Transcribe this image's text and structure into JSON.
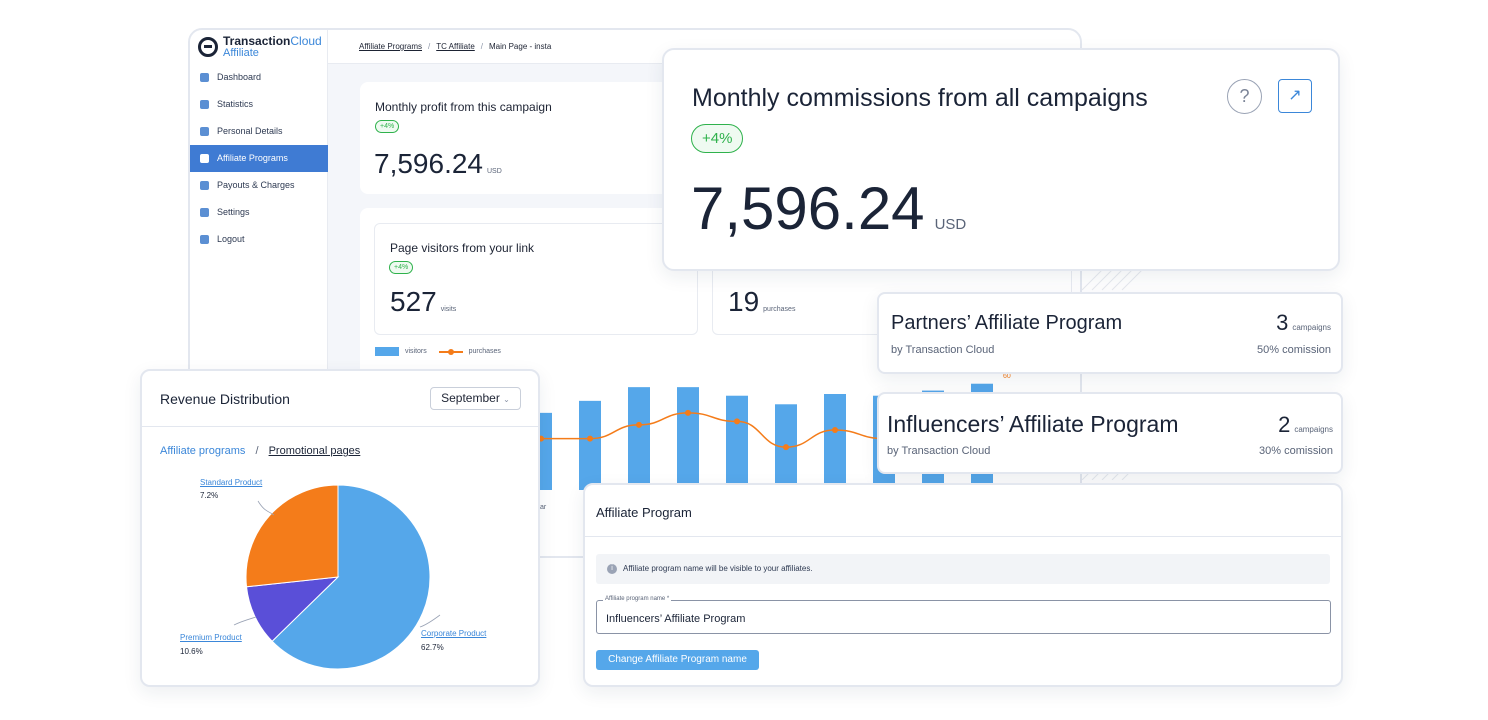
{
  "app": {
    "brand": "Transaction",
    "brand_suffix": "Cloud",
    "product": "Affiliate"
  },
  "sidebar": {
    "items": [
      {
        "label": "Dashboard",
        "icon": "bar-chart-icon"
      },
      {
        "label": "Statistics",
        "icon": "stats-icon"
      },
      {
        "label": "Personal Details",
        "icon": "user-icon"
      },
      {
        "label": "Affiliate Programs",
        "icon": "network-icon",
        "active": true
      },
      {
        "label": "Payouts & Charges",
        "icon": "wallet-icon"
      },
      {
        "label": "Settings",
        "icon": "gear-icon"
      },
      {
        "label": "Logout",
        "icon": "logout-icon"
      }
    ]
  },
  "breadcrumb": {
    "items": [
      "Affiliate Programs",
      "TC Affiliate",
      "Main Page - insta"
    ],
    "separator": "/"
  },
  "profit_card": {
    "title": "Monthly profit from this campaign",
    "badge": "+4%",
    "value": "7,596.24",
    "unit": "USD"
  },
  "visitors_card": {
    "title": "Page visitors from your link",
    "badge": "+4%",
    "value": "527",
    "unit": "visits"
  },
  "purchases_card": {
    "value": "19",
    "unit": "purchases"
  },
  "chart_data": {
    "type": "bar",
    "legend": [
      "visitors",
      "purchases"
    ],
    "series": [
      {
        "name": "visitors",
        "type": "bar",
        "values": [
          45,
          52,
          60,
          60,
          55,
          50,
          56,
          55,
          58,
          62
        ]
      },
      {
        "name": "purchases",
        "type": "line",
        "values": [
          30,
          30,
          38,
          45,
          40,
          25,
          35,
          30,
          38,
          50
        ]
      }
    ],
    "annotation": "60",
    "axis_fragment": "ar",
    "colors": {
      "visitors": "#55a7ea",
      "purchases": "#f47c1a"
    }
  },
  "commissions_card": {
    "title": "Monthly commissions from all campaigns",
    "badge": "+4%",
    "value": "7,596.24",
    "unit": "USD",
    "help": "?",
    "expand": "↗"
  },
  "programs": [
    {
      "name": "Partners’ Affiliate Program",
      "by": "by Transaction Cloud",
      "count": "3",
      "count_unit": "campaigns",
      "commission": "50% comission"
    },
    {
      "name": "Influencers’ Affiliate Program",
      "by": "by Transaction Cloud",
      "count": "2",
      "count_unit": "campaigns",
      "commission": "30% comission"
    }
  ],
  "revenue": {
    "title": "Revenue Distribution",
    "month": "September",
    "tab_inactive": "Affiliate programs",
    "tab_sep": "/",
    "tab_active": "Promotional pages",
    "slices": [
      {
        "label": "Corporate Product",
        "pct": "62.7%",
        "value": 62.7,
        "color": "#55a7ea"
      },
      {
        "label": "Premium Product",
        "pct": "10.6%",
        "value": 10.6,
        "color": "#5a4fd8"
      },
      {
        "label": "Standard Product",
        "pct": "7.2%",
        "value": 26.7,
        "color": "#f47c1a"
      }
    ]
  },
  "program_form": {
    "title": "Affiliate Program",
    "info": "Affiliate program name will be visible to your affiliates.",
    "field_label": "Affiliate program name *",
    "field_value": "Influencers’ Affiliate Program",
    "button": "Change Affiliate Program name"
  }
}
